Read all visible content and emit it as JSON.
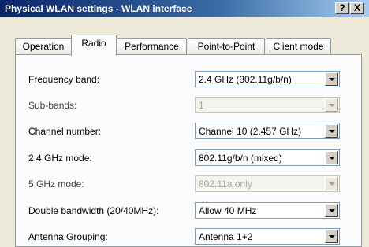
{
  "window": {
    "title": "Physical WLAN settings - WLAN interface",
    "help_button": "?",
    "close_button": "X"
  },
  "tabs": [
    {
      "label": "Operation",
      "active": false
    },
    {
      "label": "Radio",
      "active": true
    },
    {
      "label": "Performance",
      "active": false
    },
    {
      "label": "Point-to-Point",
      "active": false
    },
    {
      "label": "Client mode",
      "active": false
    }
  ],
  "fields": [
    {
      "label": "Frequency band:",
      "value": "2.4 GHz (802.11g/b/n)",
      "enabled": true
    },
    {
      "label": "Sub-bands:",
      "value": "1",
      "enabled": false
    },
    {
      "label": "Channel number:",
      "value": "Channel 10 (2.457 GHz)",
      "enabled": true
    },
    {
      "label": "2.4 GHz mode:",
      "value": "802.11g/b/n (mixed)",
      "enabled": true
    },
    {
      "label": "5 GHz mode:",
      "value": "802.11a only",
      "enabled": false
    },
    {
      "label": "Double bandwidth (20/40MHz):",
      "value": "Allow 40 MHz",
      "enabled": true
    },
    {
      "label": "Antenna Grouping:",
      "value": "Antenna 1+2",
      "enabled": true
    }
  ]
}
